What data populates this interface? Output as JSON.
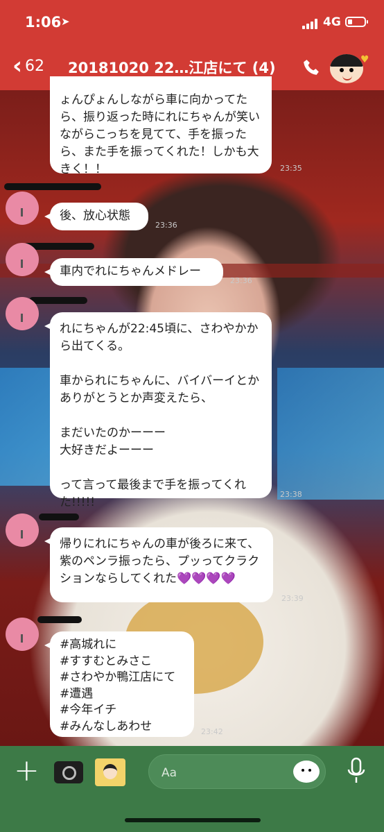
{
  "status_bar": {
    "time": "1:06",
    "location_icon": "location-arrow-icon",
    "network": "4G",
    "signal_icon": "signal-bars-icon",
    "battery_icon": "battery-low-icon"
  },
  "header": {
    "back_count": "62",
    "title": "20181020 22…江店にて (4)",
    "call_icon": "phone-icon",
    "avatar_icon": "shinchan-avatar-icon",
    "page_dots": 3,
    "active_dot": 1
  },
  "messages": [
    {
      "text": "ょんぴょんしながら車に向かってたら、振り返った時にれにちゃんが笑いながらこっちを見てて、手を振ったら、また手を振ってくれた！しかも大きく！！",
      "time": "23:35"
    },
    {
      "text": "後、放心状態",
      "time": "23:36"
    },
    {
      "text": "車内でれにちゃんメドレー",
      "time": "23:36"
    },
    {
      "text": "れにちゃんが22:45頃に、さわやかから出てくる。\n\n車かられにちゃんに、バイバーイとかありがとうとか声変えたら、\n\nまだいたのかーーー\n大好きだよーーー\n\nって言って最後まで手を振ってくれた!!!!!",
      "time": "23:38"
    },
    {
      "text": "帰りにれにちゃんの車が後ろに来て、紫のペンラ振ったら、プッってクラクションならしてくれた💜💜💜💜",
      "time": "23:39"
    },
    {
      "text": "#高城れに\n#すすむとみさこ\n#さわやか鴨江店にて\n#遭遇\n#今年イチ\n#みんなしあわせ",
      "time": "23:42"
    }
  ],
  "input": {
    "placeholder": "Aa"
  },
  "toolbar": {
    "plus_icon": "plus-icon",
    "camera_icon": "camera-icon",
    "image_icon": "photo-sticker-icon",
    "sticker_icon": "emoji-sticker-icon",
    "mic_icon": "microphone-icon"
  },
  "colors": {
    "header": "#d23b34",
    "bottombar": "#3d7a47",
    "bubble": "#ffffff"
  }
}
